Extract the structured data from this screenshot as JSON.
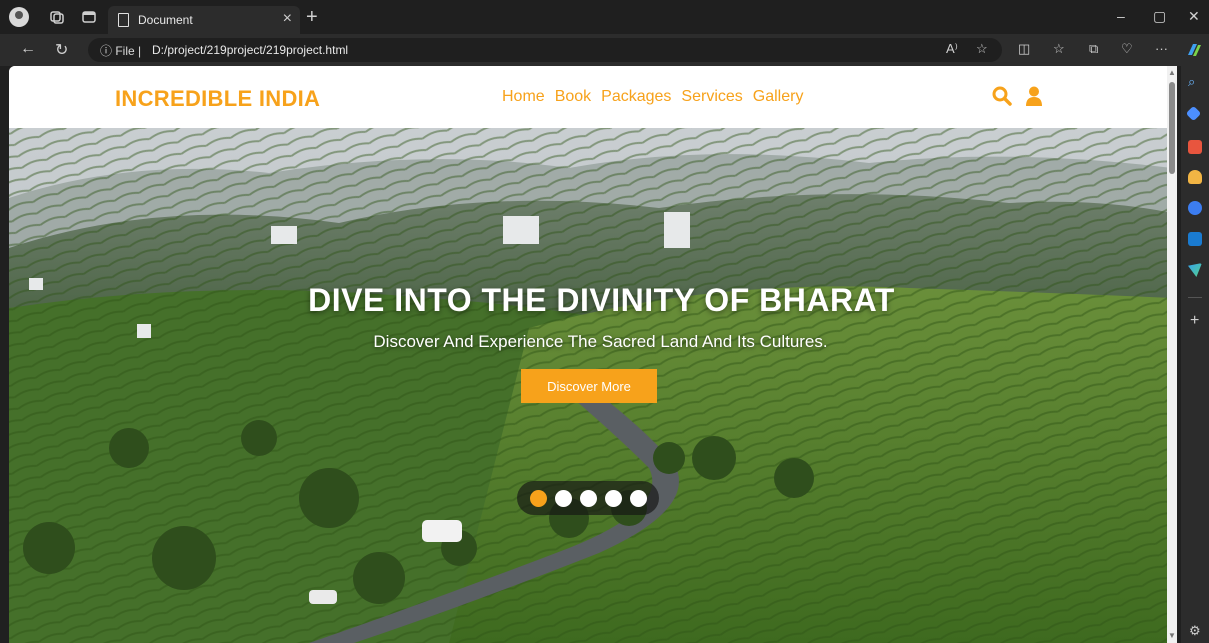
{
  "browser": {
    "tab_title": "Document",
    "tab_close": "×",
    "new_tab": "+",
    "url_prefix": "ⓘ File  |",
    "url": "D:/project/219project/219project.html",
    "read_aloud": "A⁾",
    "more": "···",
    "window_controls": [
      "–",
      "▢",
      "✕"
    ]
  },
  "site": {
    "logo": "INCREDIBLE INDIA",
    "nav": [
      "Home",
      "Book",
      "Packages",
      "Services",
      "Gallery"
    ],
    "icons": [
      "search-icon",
      "user-icon"
    ],
    "accent": "#f7a21b"
  },
  "hero": {
    "title": "DIVE INTO THE DIVINITY OF BHARAT",
    "subtitle": "Discover And Experience The Sacred Land And Its Cultures.",
    "cta": "Discover More",
    "slides": 5,
    "active_slide": 1
  },
  "sidebar_icons": [
    "search-icon",
    "tag-icon",
    "briefcase-icon",
    "people-icon",
    "copilot-icon",
    "outlook-icon",
    "send-icon",
    "add-icon",
    "settings-icon"
  ]
}
